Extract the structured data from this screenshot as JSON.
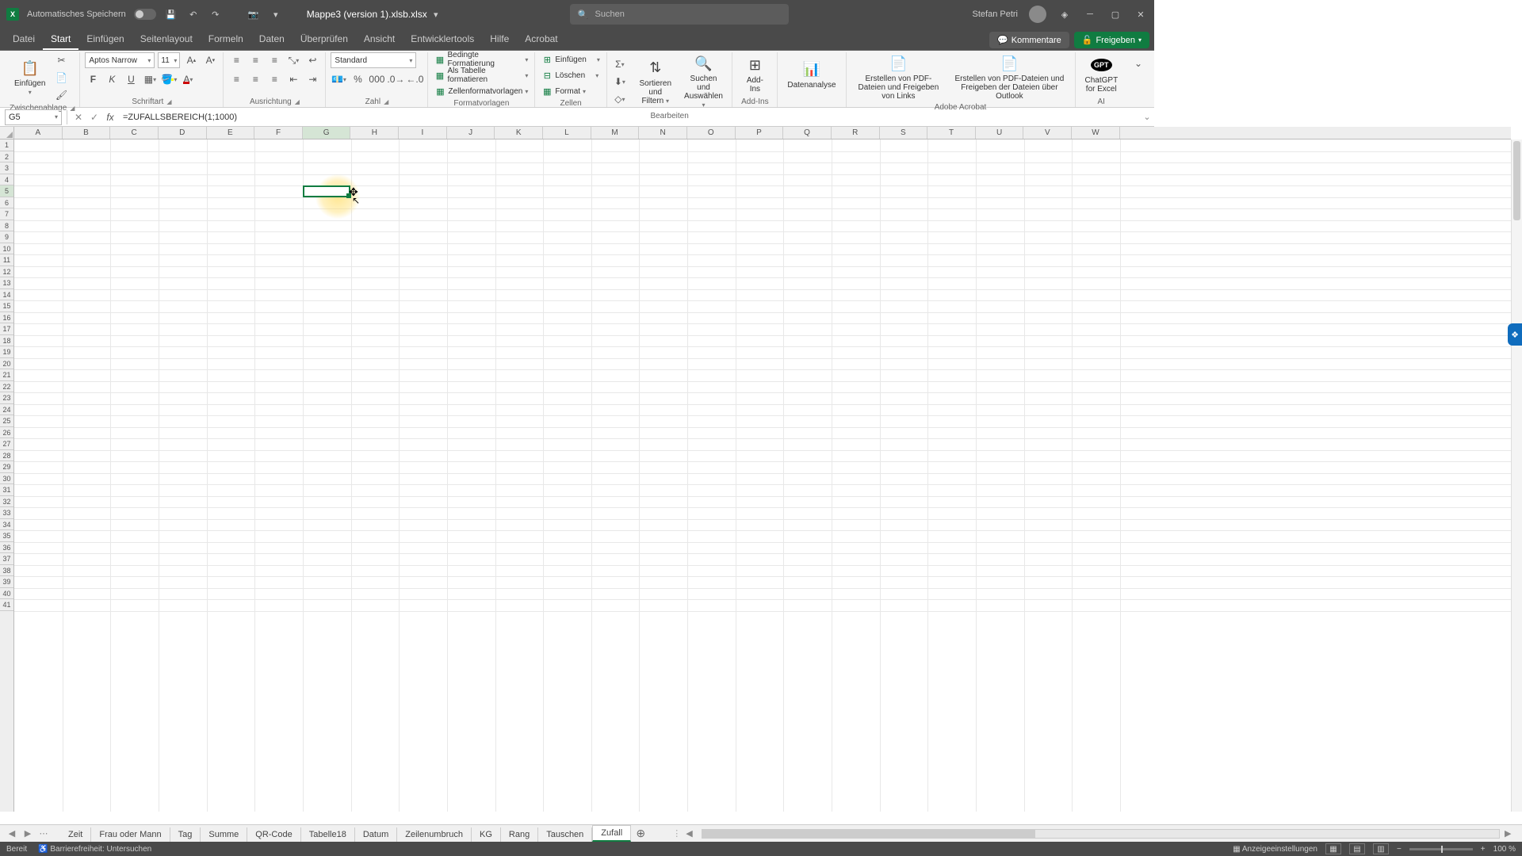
{
  "titlebar": {
    "autosave": "Automatisches Speichern",
    "filename": "Mappe3 (version 1).xlsb.xlsx",
    "search_placeholder": "Suchen",
    "username": "Stefan Petri"
  },
  "tabs": {
    "items": [
      "Datei",
      "Start",
      "Einfügen",
      "Seitenlayout",
      "Formeln",
      "Daten",
      "Überprüfen",
      "Ansicht",
      "Entwicklertools",
      "Hilfe",
      "Acrobat"
    ],
    "active": "Start",
    "comments": "Kommentare",
    "share": "Freigeben"
  },
  "ribbon": {
    "clipboard": {
      "paste": "Einfügen",
      "label": "Zwischenablage"
    },
    "font": {
      "name": "Aptos Narrow",
      "size": "11",
      "bold": "F",
      "italic": "K",
      "underline": "U",
      "label": "Schriftart"
    },
    "alignment": {
      "label": "Ausrichtung"
    },
    "number": {
      "format": "Standard",
      "label": "Zahl"
    },
    "styles": {
      "cond": "Bedingte Formatierung",
      "table": "Als Tabelle formatieren",
      "cell": "Zellenformatvorlagen",
      "label": "Formatvorlagen"
    },
    "cells": {
      "insert": "Einfügen",
      "delete": "Löschen",
      "format": "Format",
      "label": "Zellen"
    },
    "editing": {
      "sort": "Sortieren und Filtern",
      "find": "Suchen und Auswählen",
      "label": "Bearbeiten"
    },
    "addins": {
      "btn": "Add-Ins",
      "label": "Add-Ins"
    },
    "analysis": {
      "btn": "Datenanalyse"
    },
    "acrobat": {
      "btn1": "Erstellen von PDF-Dateien und Freigeben von Links",
      "btn2": "Erstellen von PDF-Dateien und Freigeben der Dateien über Outlook",
      "label": "Adobe Acrobat"
    },
    "ai": {
      "btn": "ChatGPT for Excel",
      "label": "AI"
    }
  },
  "formula_bar": {
    "cell_ref": "G5",
    "formula": "=ZUFALLSBEREICH(1;1000)"
  },
  "columns": [
    "A",
    "B",
    "C",
    "D",
    "E",
    "F",
    "G",
    "H",
    "I",
    "J",
    "K",
    "L",
    "M",
    "N",
    "O",
    "P",
    "Q",
    "R",
    "S",
    "T",
    "U",
    "V",
    "W"
  ],
  "selected_col_index": 6,
  "selected_row_index": 4,
  "row_count": 41,
  "sheets": {
    "items": [
      "Zeit",
      "Frau oder Mann",
      "Tag",
      "Summe",
      "QR-Code",
      "Tabelle18",
      "Datum",
      "Zeilenumbruch",
      "KG",
      "Rang",
      "Tauschen",
      "Zufall"
    ],
    "active": "Zufall"
  },
  "statusbar": {
    "ready": "Bereit",
    "access": "Barrierefreiheit: Untersuchen",
    "display": "Anzeigeeinstellungen",
    "zoom": "100 %"
  }
}
